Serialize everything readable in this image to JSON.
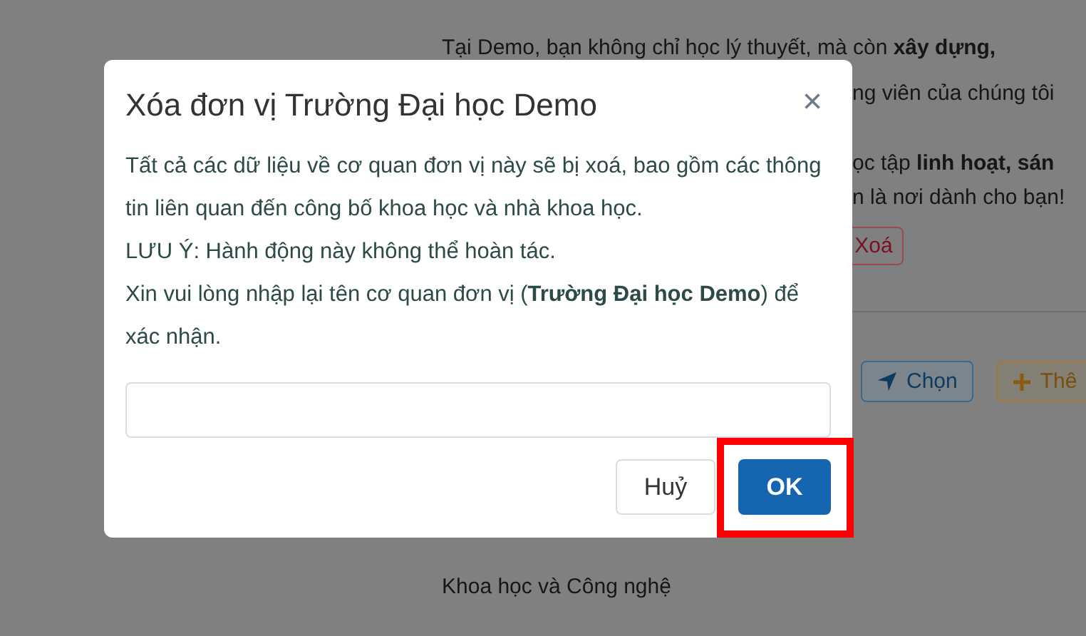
{
  "background": {
    "intro_line": "Tại Demo, bạn không chỉ học lý thuyết, mà còn **xây dựng,**",
    "fragments": [
      "ng viên của chúng tôi",
      "ọc tập **linh hoạt, sán**",
      "n là nơi dành cho bạn!"
    ],
    "delete_button": "Xoá",
    "actions": [
      {
        "kind": "select",
        "label": "Chọn"
      },
      {
        "kind": "add",
        "label": "Thê"
      }
    ],
    "list_items": [
      "Khoa học và Công nghệ"
    ]
  },
  "dialog": {
    "title": "Xóa đơn vị Trường Đại học Demo",
    "close": "×",
    "paragraphs": [
      "Tất cả các dữ liệu về cơ quan đơn vị này sẽ bị xoá, bao gồm các thông tin liên quan đến công bố khoa học và nhà khoa học.",
      "LƯU Ý: Hành động này không thể hoàn tác.",
      "Xin vui lòng nhập lại tên cơ quan đơn vị (**Trường Đại học Demo**) để xác nhận."
    ],
    "cancel": "Huỷ",
    "confirm": "OK",
    "confirm_highlighted": true
  }
}
